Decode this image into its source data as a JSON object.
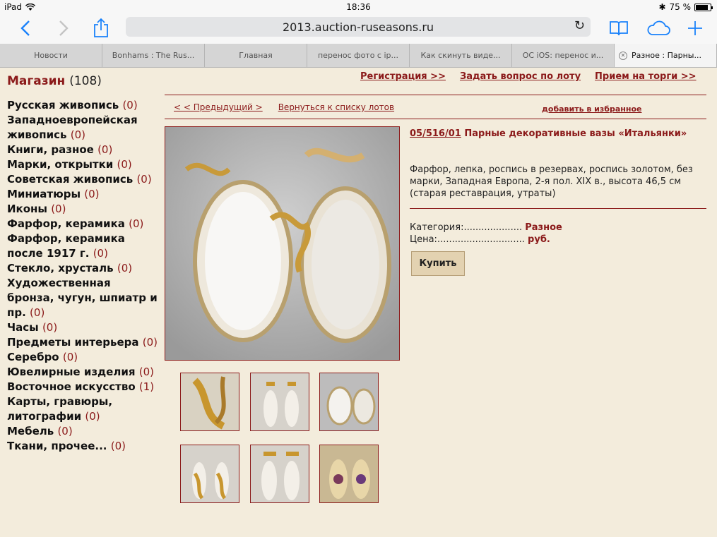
{
  "statusbar": {
    "device": "iPad",
    "time": "18:36",
    "battery": "75 %"
  },
  "toolbar": {
    "url": "2013.auction-ruseasons.ru"
  },
  "tabs": [
    "Новости",
    "Bonhams : The Rus...",
    "Главная",
    "перенос фото с ip...",
    "Как скинуть виде...",
    "ОС iOS: перенос и...",
    "Разное : Парны..."
  ],
  "sidebar": {
    "title": "Магазин",
    "count": "(108)",
    "categories": [
      {
        "name": "Русская живопись",
        "count": "(0)"
      },
      {
        "name": "Западноевропейская живопись",
        "count": "(0)"
      },
      {
        "name": "Книги, разное",
        "count": "(0)"
      },
      {
        "name": "Марки, открытки",
        "count": "(0)"
      },
      {
        "name": "Советская живопись",
        "count": "(0)"
      },
      {
        "name": "Миниатюры",
        "count": "(0)"
      },
      {
        "name": "Иконы",
        "count": "(0)"
      },
      {
        "name": "Фарфор, керамика",
        "count": "(0)"
      },
      {
        "name": "Фарфор, керамика после 1917 г.",
        "count": "(0)"
      },
      {
        "name": "Стекло, хрусталь",
        "count": "(0)"
      },
      {
        "name": "Художественная бронза, чугун, шпиатр и пр.",
        "count": "(0)"
      },
      {
        "name": "Часы",
        "count": "(0)"
      },
      {
        "name": "Предметы интерьера",
        "count": "(0)"
      },
      {
        "name": "Серебро",
        "count": "(0)"
      },
      {
        "name": "Ювелирные изделия",
        "count": "(0)"
      },
      {
        "name": "Восточное искусство",
        "count": "(1)"
      },
      {
        "name": "Карты, гравюры, литографии",
        "count": "(0)"
      },
      {
        "name": "Мебель",
        "count": "(0)"
      },
      {
        "name": "Ткани, прочее...",
        "count": "(0)"
      }
    ]
  },
  "topnav": {
    "register": "Регистрация >>",
    "ask": "Задать вопрос по лоту",
    "accept": "Прием на торги >>"
  },
  "lotnav": {
    "prevnext": "< < Предыдущий >",
    "back": "Вернуться к списку лотов",
    "favorite": "добавить в избранное"
  },
  "lot": {
    "number": "05/516/01",
    "title": "Парные декоративные вазы «Итальянки»",
    "description": "Фарфор, лепка, роспись в резервах, роспись золотом, без марки, Западная Европа, 2-я пол. XIX в., высота 46,5 см (старая реставрация, утраты)",
    "category_label": "Категория:....................",
    "category_value": "Разное",
    "price_label": "Цена:..............................",
    "price_value": "руб.",
    "buy_label": "Купить"
  }
}
